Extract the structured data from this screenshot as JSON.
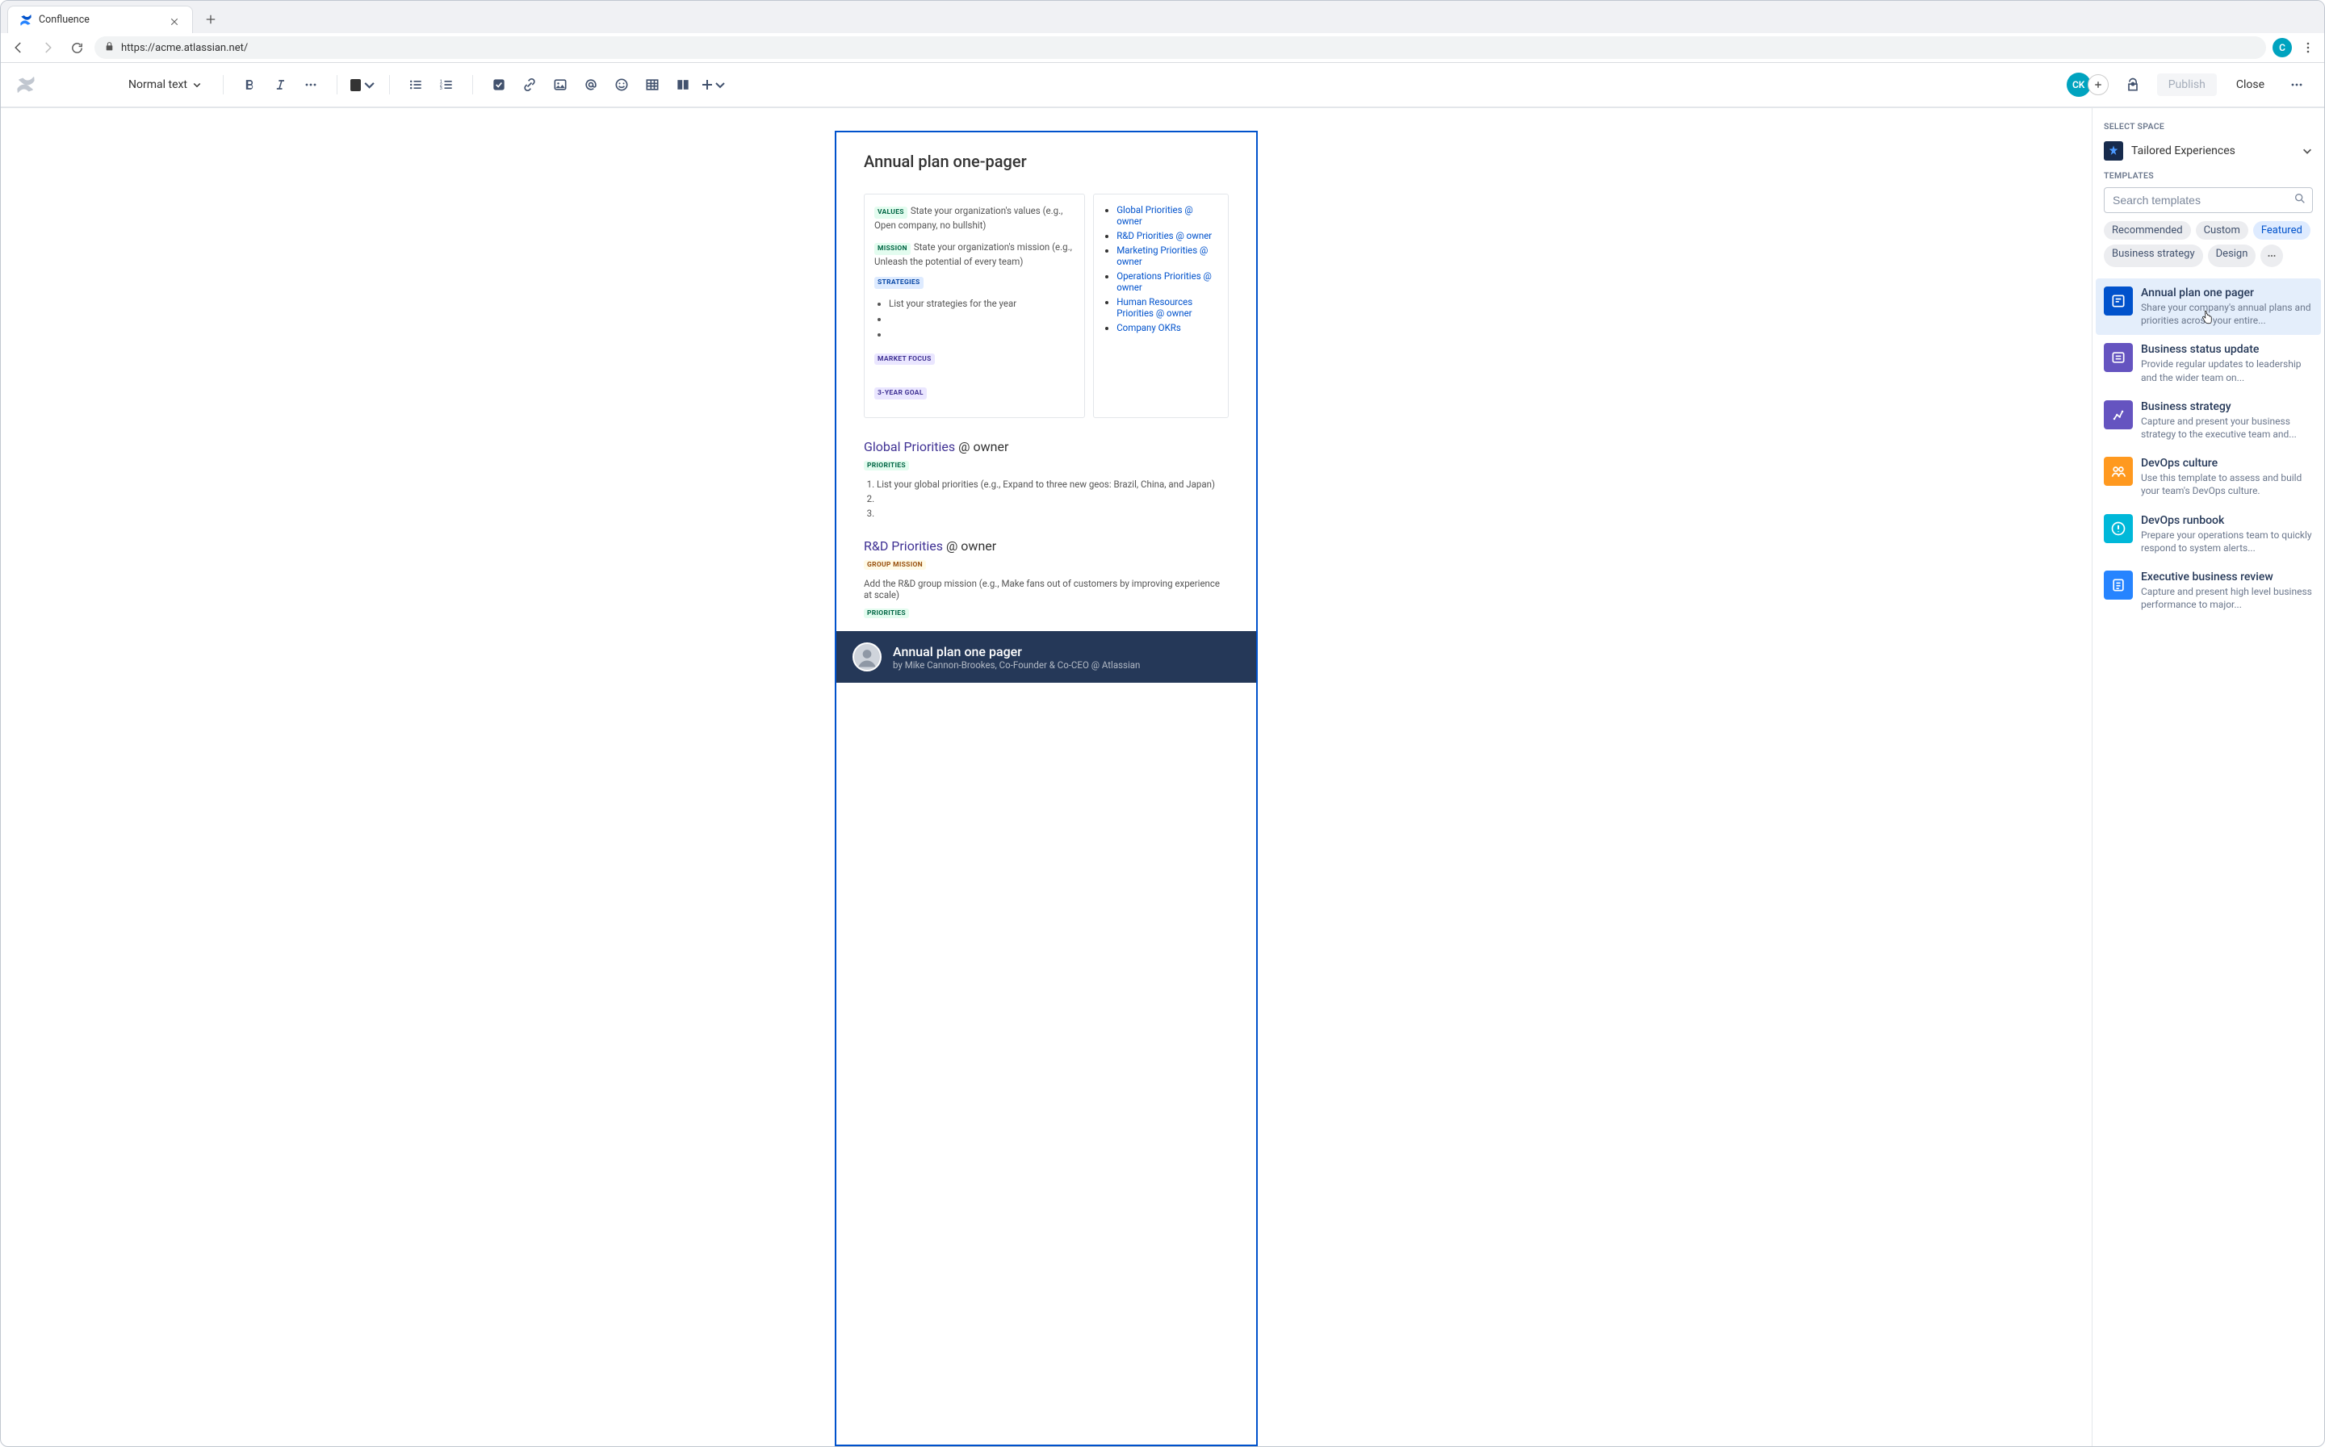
{
  "browser": {
    "tab_title": "Confluence",
    "url": "https://acme.atlassian.net/",
    "profile_initial": "C"
  },
  "toolbar": {
    "text_style": "Normal text",
    "publish": "Publish",
    "close": "Close",
    "avatar_initials": "CK"
  },
  "page": {
    "title": "Annual plan one-pager",
    "values_tag": "VALUES",
    "values_text": "State your organization's values (e.g., Open company, no bullshit)",
    "mission_tag": "MISSION",
    "mission_text": "State your organization's mission (e.g., Unleash the potential of every team)",
    "strategies_tag": "STRATEGIES",
    "strategies_item": "List your strategies for the year",
    "market_focus_tag": "MARKET FOCUS",
    "goal_tag": "3-YEAR GOAL",
    "links": [
      "Global Priorities @ owner",
      "R&D Priorities @ owner",
      "Marketing Priorities @ owner",
      "Operations Priorities @ owner",
      "Human Resources Priorities @ owner",
      "Company OKRs"
    ],
    "section1_link": "Global Priorities",
    "section1_owner": " @ owner",
    "section1_tag": "PRIORITIES",
    "section1_item": "List your global priorities (e.g., Expand to three new geos: Brazil, China, and Japan)",
    "section2_link": "R&D Priorities",
    "section2_owner": " @ owner",
    "section2_tag": "GROUP MISSION",
    "section2_text": "Add the R&D group mission (e.g., Make fans out of customers by improving experience at scale)",
    "section2_tag2": "PRIORITIES"
  },
  "footer": {
    "title": "Annual plan one pager",
    "byline": "by Mike Cannon-Brookes, Co-Founder & Co-CEO @ Atlassian"
  },
  "panel": {
    "select_space": "SELECT SPACE",
    "space_name": "Tailored Experiences",
    "templates_label": "TEMPLATES",
    "search_placeholder": "Search templates",
    "chips": {
      "recommended": "Recommended",
      "custom": "Custom",
      "featured": "Featured",
      "business_strategy": "Business strategy",
      "design": "Design"
    },
    "templates": [
      {
        "name": "Annual plan one pager",
        "desc": "Share your company's annual plans and priorities across your entire..."
      },
      {
        "name": "Business status update",
        "desc": "Provide regular updates to leadership and the wider team on..."
      },
      {
        "name": "Business strategy",
        "desc": "Capture and present your business strategy to the executive team and..."
      },
      {
        "name": "DevOps culture",
        "desc": "Use this template to assess and build your team's DevOps culture."
      },
      {
        "name": "DevOps runbook",
        "desc": "Prepare your operations team to quickly respond to system alerts..."
      },
      {
        "name": "Executive business review",
        "desc": "Capture and present high level business performance to major..."
      }
    ]
  }
}
